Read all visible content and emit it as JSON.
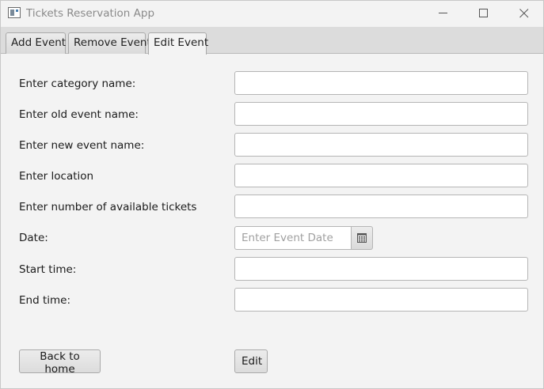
{
  "window": {
    "title": "Tickets Reservation App"
  },
  "tabs": [
    {
      "label": "Add Event",
      "selected": false
    },
    {
      "label": "Remove Event",
      "selected": false
    },
    {
      "label": "Edit Event",
      "selected": true
    }
  ],
  "form": {
    "category": {
      "label": "Enter category name:",
      "value": ""
    },
    "old_event": {
      "label": "Enter old event name:",
      "value": ""
    },
    "new_event": {
      "label": "Enter new event name:",
      "value": ""
    },
    "location": {
      "label": "Enter location",
      "value": ""
    },
    "tickets": {
      "label": "Enter number of available tickets",
      "value": ""
    },
    "date": {
      "label": "Date:",
      "value": "",
      "placeholder": "Enter Event Date",
      "picker_icon": "calendar-icon"
    },
    "start_time": {
      "label": "Start time:",
      "value": ""
    },
    "end_time": {
      "label": "End time:",
      "value": ""
    }
  },
  "buttons": {
    "back_label": "Back to home",
    "edit_label": "Edit"
  },
  "icons": {
    "app": "app-window-icon",
    "minimize": "minimize-icon",
    "maximize": "maximize-icon",
    "close": "close-icon"
  }
}
